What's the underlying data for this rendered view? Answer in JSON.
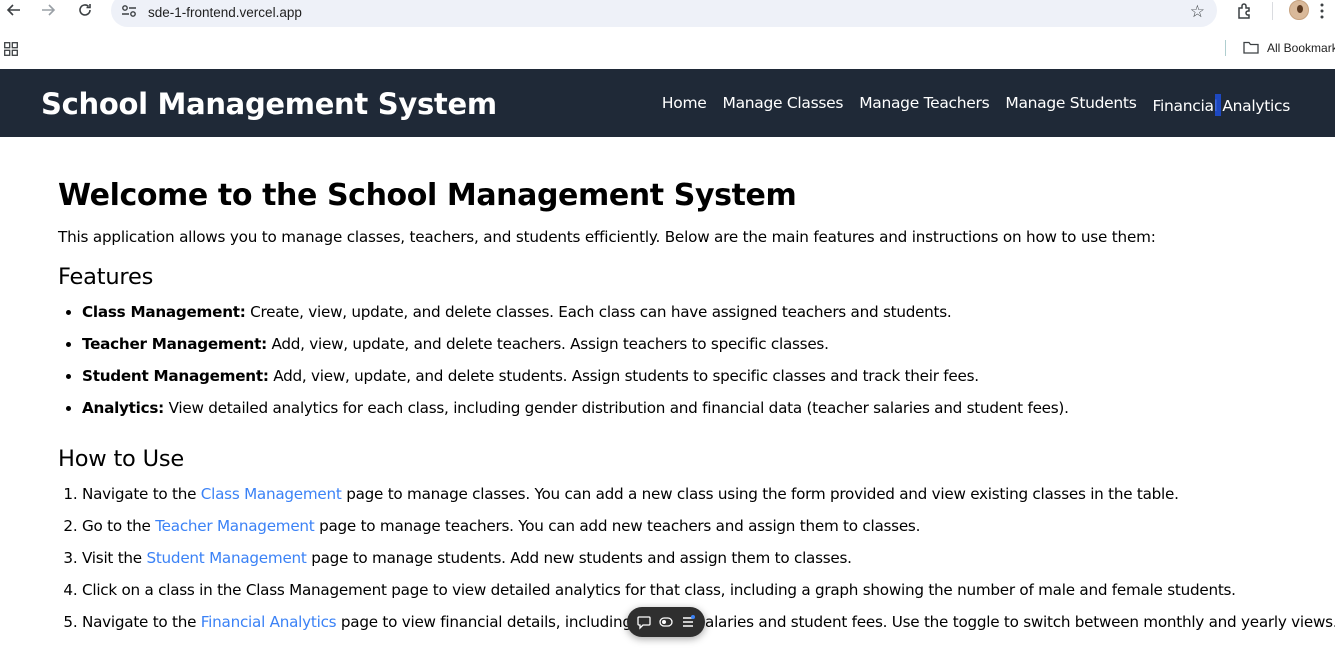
{
  "browser": {
    "url": "sde-1-frontend.vercel.app",
    "bookmarks_label": "All Bookmarks"
  },
  "header": {
    "title": "School Management System",
    "nav": [
      {
        "label": "Home"
      },
      {
        "label": "Manage Classes"
      },
      {
        "label": "Manage Teachers"
      },
      {
        "label": "Manage Students"
      },
      {
        "label_part1": "Financial",
        "label_part2": "Analytics"
      }
    ]
  },
  "main": {
    "title": "Welcome to the School Management System",
    "intro": "This application allows you to manage classes, teachers, and students efficiently. Below are the main features and instructions on how to use them:",
    "features_heading": "Features",
    "features": [
      {
        "name": "Class Management:",
        "text": " Create, view, update, and delete classes. Each class can have assigned teachers and students."
      },
      {
        "name": "Teacher Management:",
        "text": " Add, view, update, and delete teachers. Assign teachers to specific classes."
      },
      {
        "name": "Student Management:",
        "text": " Add, view, update, and delete students. Assign students to specific classes and track their fees."
      },
      {
        "name": "Analytics:",
        "text": " View detailed analytics for each class, including gender distribution and financial data (teacher salaries and student fees)."
      }
    ],
    "howto_heading": "How to Use",
    "steps": [
      {
        "before": "Navigate to the ",
        "link": "Class Management",
        "after": " page to manage classes. You can add a new class using the form provided and view existing classes in the table."
      },
      {
        "before": "Go to the ",
        "link": "Teacher Management",
        "after": " page to manage teachers. You can add new teachers and assign them to classes."
      },
      {
        "before": "Visit the ",
        "link": "Student Management",
        "after": " page to manage students. Add new students and assign them to classes."
      },
      {
        "text": "Click on a class in the Class Management page to view detailed analytics for that class, including a graph showing the number of male and female students."
      },
      {
        "before": "Navigate to the ",
        "link": "Financial Analytics",
        "after": " page to view financial details, including teacher salaries and student fees. Use the toggle to switch between monthly and yearly views."
      }
    ]
  },
  "colors": {
    "header_bg": "#1f2937",
    "link": "#3b82f6"
  }
}
